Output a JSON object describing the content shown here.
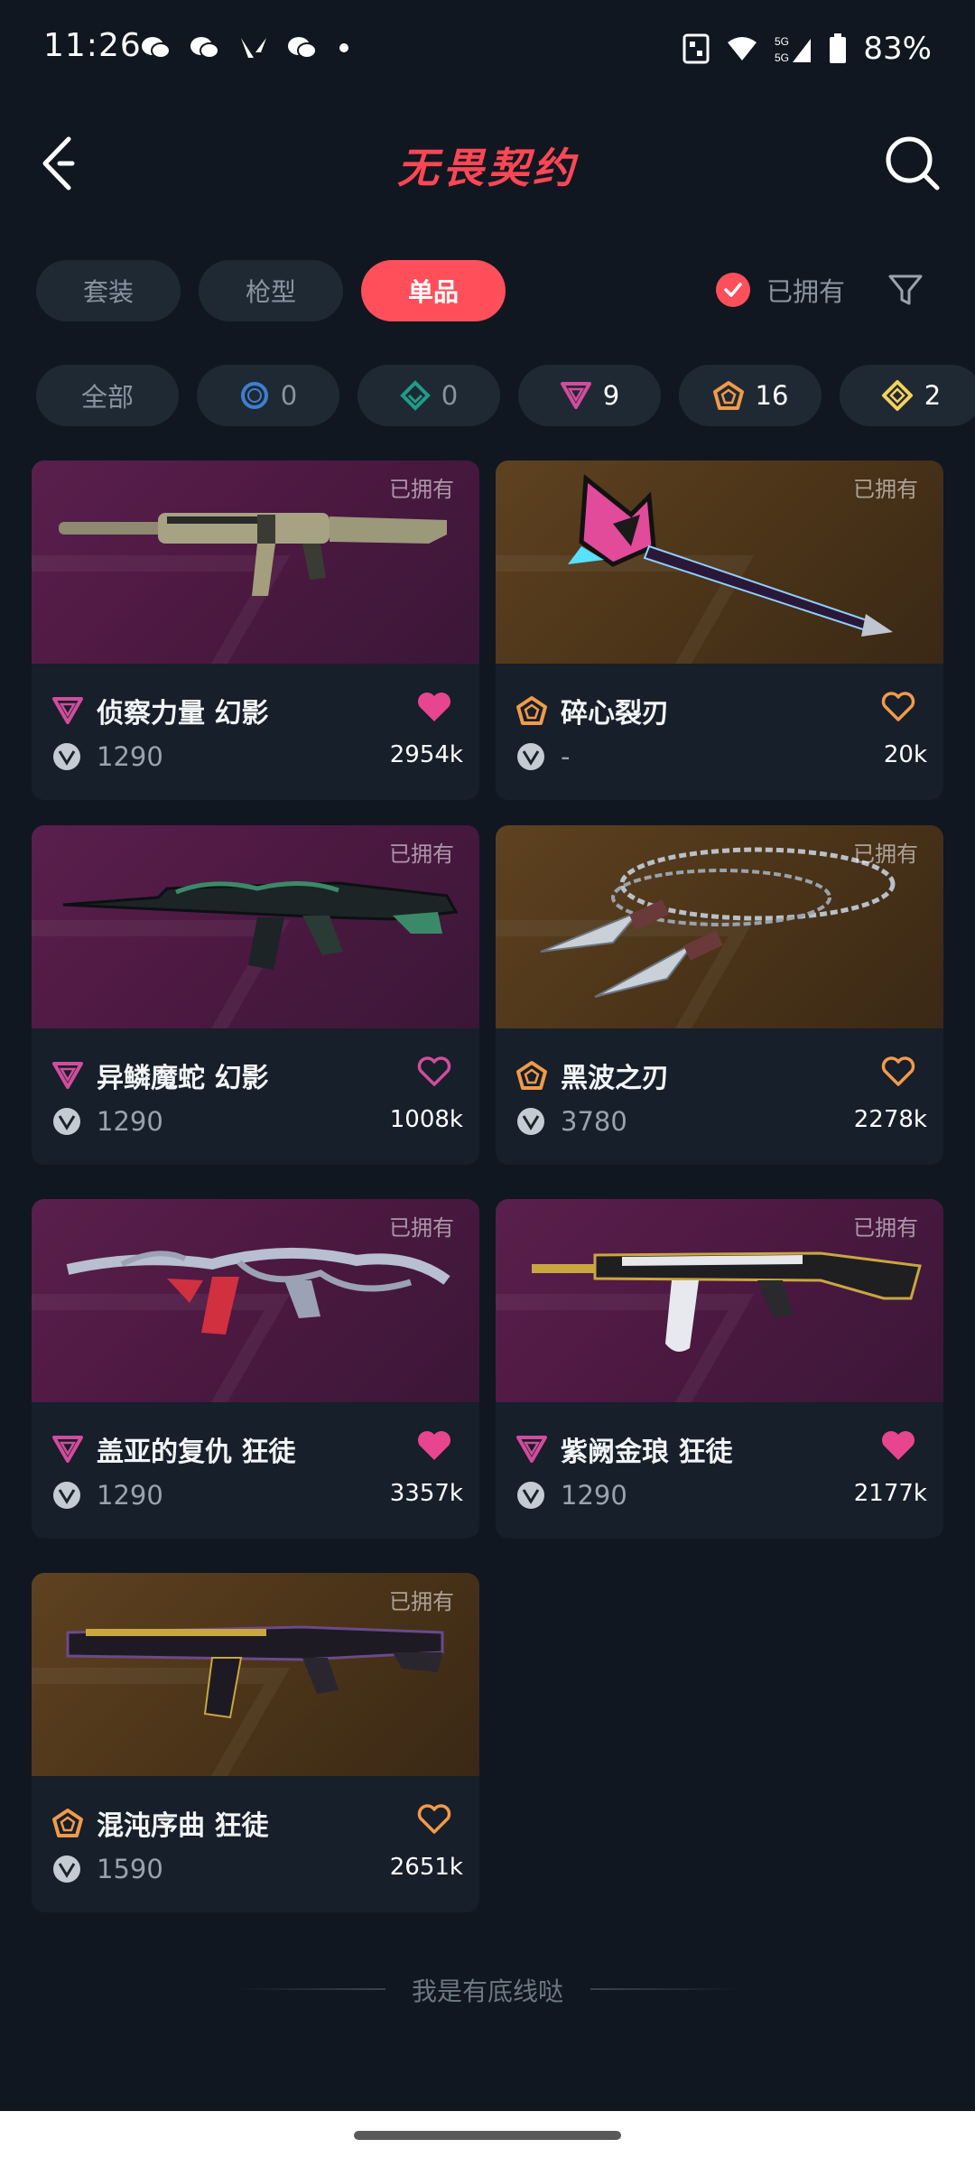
{
  "status_bar": {
    "time": "11:26",
    "battery": "83%",
    "network": "5G"
  },
  "header": {
    "title": "无畏契约"
  },
  "category_tabs": [
    {
      "label": "套装",
      "active": false
    },
    {
      "label": "枪型",
      "active": false
    },
    {
      "label": "单品",
      "active": true
    }
  ],
  "owned_filter": {
    "label": "已拥有",
    "checked": true
  },
  "rarity_chips": [
    {
      "label": "全部",
      "icon": null
    },
    {
      "count": "0",
      "icon": "select-tier-icon",
      "color": "#3d7fcf"
    },
    {
      "count": "0",
      "icon": "deluxe-tier-icon",
      "color": "#1f9c87"
    },
    {
      "count": "9",
      "icon": "premium-tier-icon",
      "color": "#d14d9b"
    },
    {
      "count": "16",
      "icon": "exclusive-tier-icon",
      "color": "#f29a4a"
    },
    {
      "count": "2",
      "icon": "ultra-tier-icon",
      "color": "#f5d15a"
    }
  ],
  "items": [
    {
      "owned_tag": "已拥有",
      "name": "侦察力量 幻影",
      "price": "1290",
      "likes": "2954k",
      "tier": "premium",
      "liked": true,
      "bg": "purple",
      "weapon": "rifle-olive"
    },
    {
      "owned_tag": "已拥有",
      "name": "碎心裂刃",
      "price": "-",
      "likes": "20k",
      "tier": "exclusive",
      "liked": false,
      "bg": "gold",
      "weapon": "blade-neon"
    },
    {
      "owned_tag": "已拥有",
      "name": "异鳞魔蛇 幻影",
      "price": "1290",
      "likes": "1008k",
      "tier": "premium",
      "liked": false,
      "bg": "purple",
      "weapon": "rifle-serpent"
    },
    {
      "owned_tag": "已拥有",
      "name": "黑波之刃",
      "price": "3780",
      "likes": "2278k",
      "tier": "exclusive",
      "liked": false,
      "bg": "gold",
      "weapon": "kunai-chain"
    },
    {
      "owned_tag": "已拥有",
      "name": "盖亚的复仇 狂徒",
      "price": "1290",
      "likes": "3357k",
      "tier": "premium",
      "liked": true,
      "bg": "purple",
      "weapon": "rifle-vine"
    },
    {
      "owned_tag": "已拥有",
      "name": "紫阙金琅 狂徒",
      "price": "1290",
      "likes": "2177k",
      "tier": "premium",
      "liked": true,
      "bg": "purple",
      "weapon": "rifle-gold"
    },
    {
      "owned_tag": "已拥有",
      "name": "混沌序曲 狂徒",
      "price": "1590",
      "likes": "2651k",
      "tier": "exclusive",
      "liked": false,
      "bg": "gold",
      "weapon": "rifle-dark"
    }
  ],
  "footer_text": "我是有底线哒",
  "colors": {
    "accent": "#ff4f5a",
    "premium": "#d14d9b",
    "exclusive": "#f29a4a",
    "heart_on": "#e8458f"
  }
}
